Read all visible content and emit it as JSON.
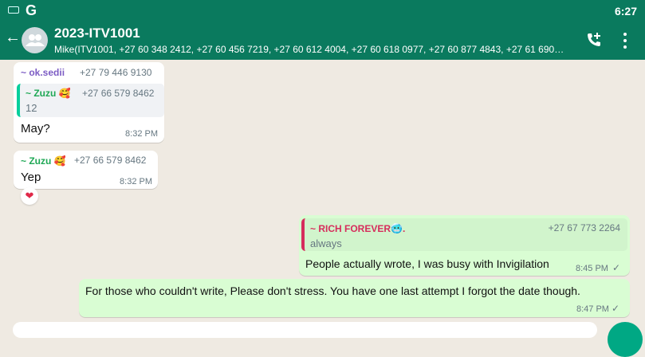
{
  "status_bar": {
    "time": "6:27",
    "app_letter": "G"
  },
  "header": {
    "title": "2023-ITV1001",
    "members": "Mike(ITV1001, +27 60 348 2412, +27 60 456 7219, +27 60 612 4004, +27 60 618 0977, +27 60 877 4843, +27 61 690…"
  },
  "messages": {
    "m1": {
      "sender": "~ ok.sedii",
      "sender_color": "#7c5cc4",
      "phone": "+27 79 446 9130",
      "quote": {
        "sender": "~ Zuzu 🥰",
        "sender_color": "#1fa855",
        "phone": "+27 66 579 8462",
        "text": "12"
      },
      "text": "May?",
      "time": "8:32 PM"
    },
    "m2": {
      "sender": "~ Zuzu 🥰",
      "sender_color": "#1fa855",
      "phone": "+27 66 579 8462",
      "text": "Yep",
      "time": "8:32 PM",
      "reaction": "❤"
    },
    "m3": {
      "quote": {
        "sender": "~ RICH FOREVER🥶.",
        "sender_color": "#d62d5c",
        "phone": "+27 67 773 2264",
        "text": "always"
      },
      "text": "People actually wrote, I was busy with Invigilation",
      "time": "8:45 PM",
      "status": "✓"
    },
    "m4": {
      "text": "For those who couldn't write, Please don't stress. You have one last attempt I forgot the date though.",
      "time": "8:47 PM",
      "status": "✓"
    }
  }
}
